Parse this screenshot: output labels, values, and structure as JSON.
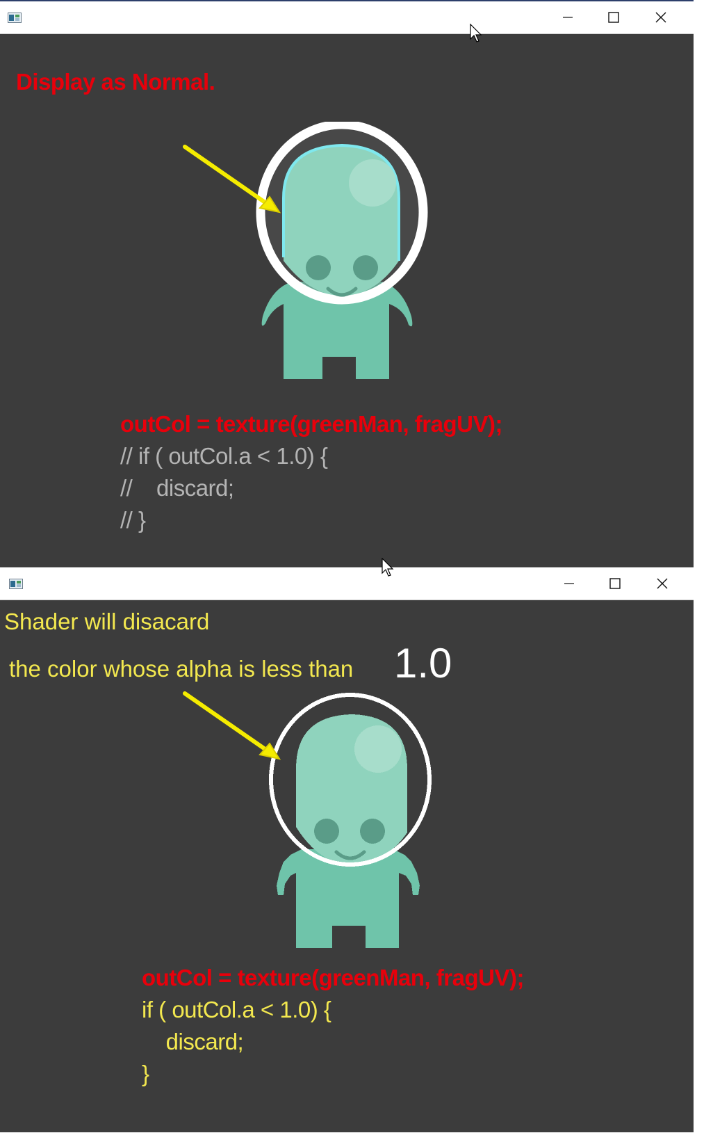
{
  "window_top": {
    "titlebar": {
      "icon": "app-window-icon",
      "minimize_icon": "minimize-icon",
      "maximize_icon": "maximize-icon",
      "close_icon": "close-icon"
    },
    "heading": "Display as Normal.",
    "code_lines": [
      "outCol = texture(greenMan, fragUV);",
      "// if ( outCol.a < 1.0) {",
      "//    discard;",
      "// }"
    ]
  },
  "window_bottom": {
    "titlebar": {
      "icon": "app-window-icon",
      "minimize_icon": "minimize-icon",
      "maximize_icon": "maximize-icon",
      "close_icon": "close-icon"
    },
    "heading_line1": "Shader will disacard",
    "heading_line2": "the color whose alpha is less than",
    "heading_value": "1.0",
    "code_lines": [
      "outCol = texture(greenMan, fragUV);",
      "if ( outCol.a < 1.0) {",
      "    discard;",
      "}"
    ]
  },
  "colors": {
    "background": "#3c3c3c",
    "alien_body": "#6fc4aa",
    "alien_head": "#8fd3bd",
    "arrow": "#f5ec00",
    "outline": "#7fe8ee",
    "red_text": "#e8000b",
    "yellow_text": "#f3e84f",
    "gray_text": "#b4b4b4"
  }
}
